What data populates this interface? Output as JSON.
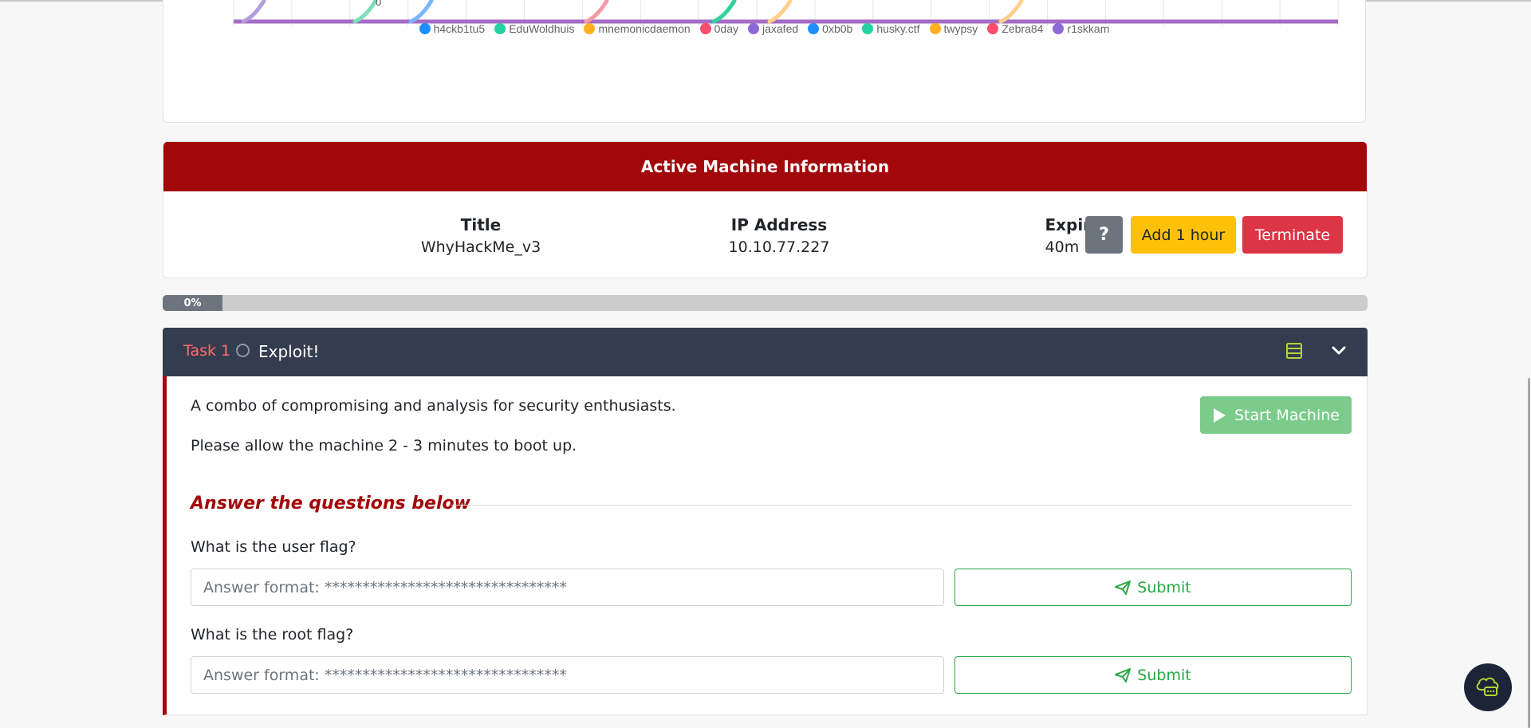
{
  "chart": {
    "y_zero_label": "0",
    "legend": [
      {
        "name": "h4ckb1tu5",
        "color": "#1f8fff"
      },
      {
        "name": "EduWoldhuis",
        "color": "#22d3a0"
      },
      {
        "name": "mnemonicdaemon",
        "color": "#ffb020"
      },
      {
        "name": "0day",
        "color": "#ff4d6d"
      },
      {
        "name": "jaxafed",
        "color": "#8e6ad8"
      },
      {
        "name": "0xb0b",
        "color": "#1f8fff"
      },
      {
        "name": "husky.ctf",
        "color": "#22d3a0"
      },
      {
        "name": "twypsy",
        "color": "#ffb020"
      },
      {
        "name": "Zebra84",
        "color": "#ff4d6d"
      },
      {
        "name": "r1skkam",
        "color": "#8e6ad8"
      }
    ]
  },
  "machine": {
    "header": "Active Machine Information",
    "title_label": "Title",
    "title_value": "WhyHackMe_v3",
    "ip_label": "IP Address",
    "ip_value": "10.10.77.227",
    "expires_label": "Expires",
    "expires_value": "40m 12s",
    "help_label": "?",
    "add_hour_label": "Add 1 hour",
    "terminate_label": "Terminate"
  },
  "progress": {
    "value": 0,
    "label": "0%"
  },
  "task": {
    "number_label": "Task 1",
    "title": "Exploit!",
    "description": "A combo of compromising and analysis for security enthusiasts.",
    "boot_note": "Please allow the machine 2 - 3 minutes to boot up.",
    "start_machine_label": "Start Machine",
    "answer_heading": "Answer the questions below",
    "questions": [
      {
        "label": "What is the user flag?",
        "placeholder": "Answer format: ********************************",
        "submit_label": "Submit"
      },
      {
        "label": "What is the root flag?",
        "placeholder": "Answer format: ********************************",
        "submit_label": "Submit"
      }
    ]
  },
  "colors": {
    "brand_red": "#a20709",
    "task_header": "#343d4f",
    "success": "#28a745",
    "warning": "#ffc107",
    "danger": "#dc3545"
  }
}
